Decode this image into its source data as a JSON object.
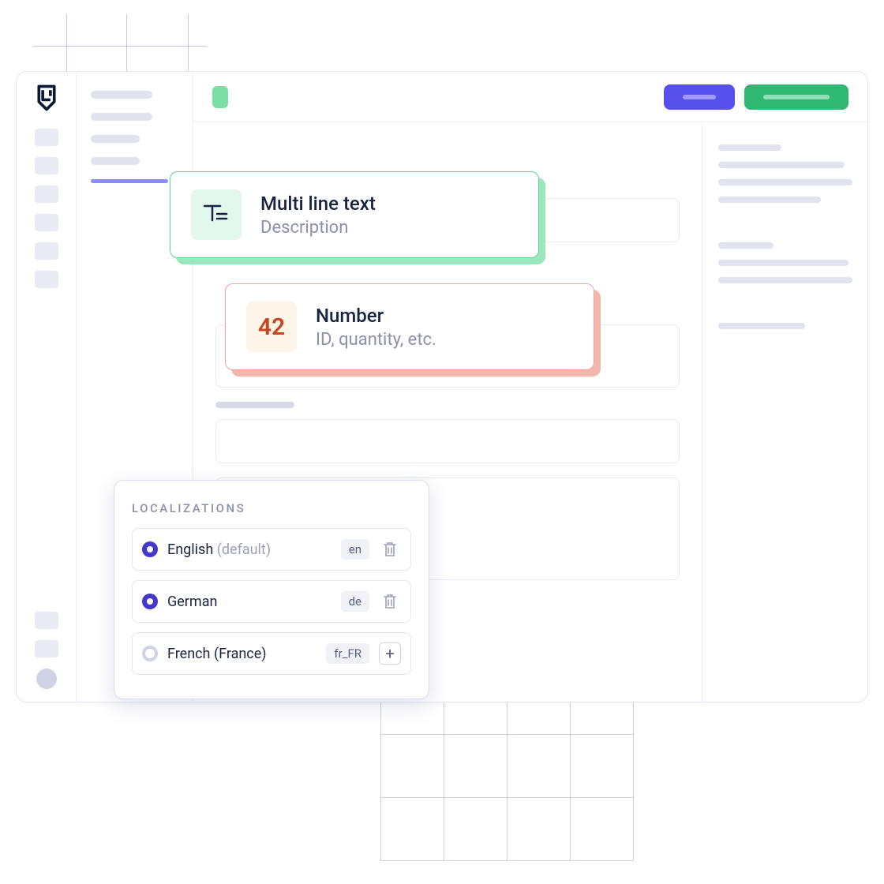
{
  "cards": {
    "multiline": {
      "title": "Multi line text",
      "subtitle": "Description",
      "icon_label": "T="
    },
    "number": {
      "title": "Number",
      "subtitle": "ID, quantity, etc.",
      "icon_label": "42"
    }
  },
  "localizations": {
    "title": "LOCALIZATIONS",
    "items": [
      {
        "name": "English",
        "suffix": "(default)",
        "code": "en",
        "selected": true,
        "removable": true
      },
      {
        "name": "German",
        "suffix": "",
        "code": "de",
        "selected": true,
        "removable": true
      },
      {
        "name": "French (France)",
        "suffix": "",
        "code": "fr_FR",
        "selected": false,
        "removable": false
      }
    ]
  }
}
